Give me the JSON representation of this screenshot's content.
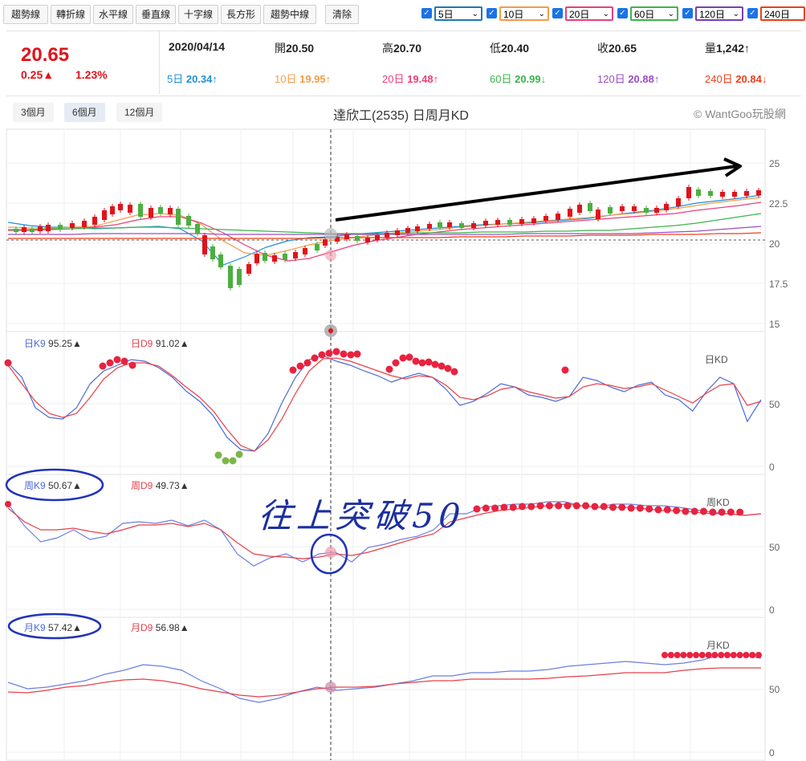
{
  "toolbar": {
    "buttons": [
      "趨勢線",
      "轉折線",
      "水平線",
      "垂直線",
      "十字線",
      "長方形",
      "趨勢中線",
      "清除"
    ],
    "ma_selectors": [
      {
        "label": "5日",
        "color": "#1f77b4"
      },
      {
        "label": "10日",
        "color": "#f39c4a"
      },
      {
        "label": "20日",
        "color": "#e8407a"
      },
      {
        "label": "60日",
        "color": "#3cb44b"
      },
      {
        "label": "120日",
        "color": "#7a3fb5"
      },
      {
        "label": "240日",
        "color": "#e8401c"
      }
    ]
  },
  "quote": {
    "price": "20.65",
    "change": "0.25▲",
    "change_pct": "1.23%",
    "date": "2020/04/14",
    "open_label": "開",
    "open": "20.50",
    "high_label": "高",
    "high": "20.70",
    "low_label": "低",
    "low": "20.40",
    "close_label": "收",
    "close": "20.65",
    "volume_label": "量",
    "volume": "1,242↑",
    "ma": [
      {
        "label": "5日",
        "value": "20.34↑",
        "color": "#1f8fd6"
      },
      {
        "label": "10日",
        "value": "19.95↑",
        "color": "#f39c4a"
      },
      {
        "label": "20日",
        "value": "19.48↑",
        "color": "#e8407a"
      },
      {
        "label": "60日",
        "value": "20.99↓",
        "color": "#3cb44b"
      },
      {
        "label": "120日",
        "value": "20.88↑",
        "color": "#9b4fc0"
      },
      {
        "label": "240日",
        "value": "20.84↓",
        "color": "#e8401c"
      }
    ]
  },
  "ranges": [
    "3個月",
    "6個月",
    "12個月"
  ],
  "chart_title": "達欣工(2535) 日周月KD",
  "copyright": "© WantGoo玩股網",
  "price_axis": [
    "25",
    "22.5",
    "20",
    "17.5",
    "15"
  ],
  "kd_axis": [
    "50",
    "0"
  ],
  "panels": {
    "day": {
      "k_label": "日K9",
      "k_value": "95.25▲",
      "d_label": "日D9",
      "d_value": "91.02▲",
      "name": "日KD"
    },
    "week": {
      "k_label": "周K9",
      "k_value": "50.67▲",
      "d_label": "周D9",
      "d_value": "49.73▲",
      "name": "周KD"
    },
    "month": {
      "k_label": "月K9",
      "k_value": "57.42▲",
      "d_label": "月D9",
      "d_value": "56.98▲",
      "name": "月KD"
    }
  },
  "annotation": "往上突破50"
}
